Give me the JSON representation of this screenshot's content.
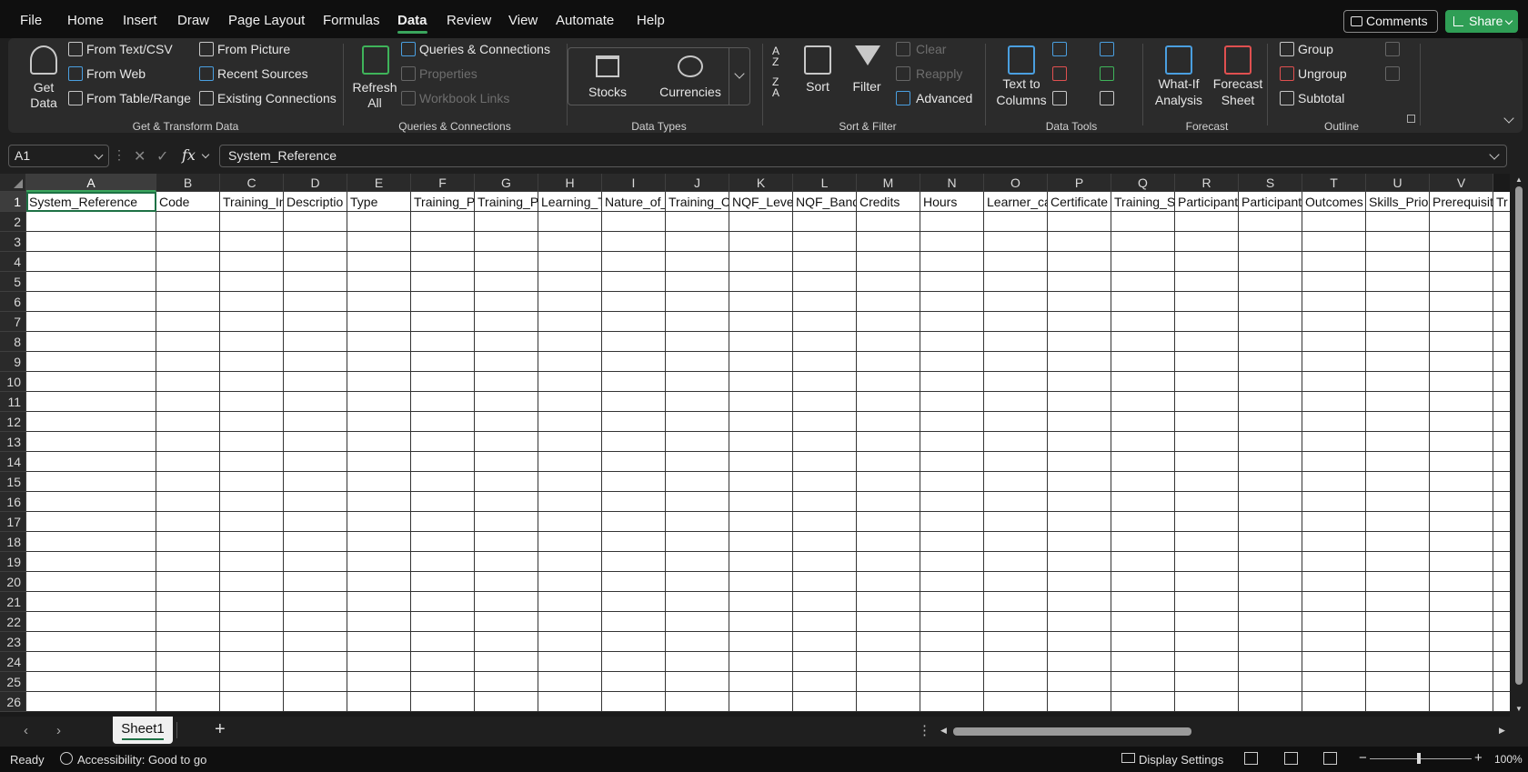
{
  "menu": {
    "tabs": [
      "File",
      "Home",
      "Insert",
      "Draw",
      "Page Layout",
      "Formulas",
      "Data",
      "Review",
      "View",
      "Automate",
      "Help"
    ],
    "active_tab": "Data",
    "comments_label": "Comments",
    "share_label": "Share"
  },
  "ribbon": {
    "get_transform": {
      "get_data_line1": "Get",
      "get_data_line2": "Data",
      "from_text_csv": "From Text/CSV",
      "from_web": "From Web",
      "from_table_range": "From Table/Range",
      "from_picture": "From Picture",
      "recent_sources": "Recent Sources",
      "existing_connections": "Existing Connections",
      "label": "Get & Transform Data"
    },
    "queries": {
      "refresh_line1": "Refresh",
      "refresh_line2": "All",
      "queries_connections": "Queries & Connections",
      "properties": "Properties",
      "workbook_links": "Workbook Links",
      "label": "Queries & Connections"
    },
    "data_types": {
      "stocks": "Stocks",
      "currencies": "Currencies",
      "label": "Data Types"
    },
    "sort_filter": {
      "sort": "Sort",
      "filter": "Filter",
      "clear": "Clear",
      "reapply": "Reapply",
      "advanced": "Advanced",
      "label": "Sort & Filter"
    },
    "data_tools": {
      "text_to_columns_line1": "Text to",
      "text_to_columns_line2": "Columns",
      "label": "Data Tools"
    },
    "forecast": {
      "what_if_line1": "What-If",
      "what_if_line2": "Analysis",
      "forecast_sheet_line1": "Forecast",
      "forecast_sheet_line2": "Sheet",
      "label": "Forecast"
    },
    "outline": {
      "group": "Group",
      "ungroup": "Ungroup",
      "subtotal": "Subtotal",
      "label": "Outline"
    }
  },
  "formula_bar": {
    "name_box": "A1",
    "fx": "fx",
    "value": "System_Reference"
  },
  "grid": {
    "columns": [
      "A",
      "B",
      "C",
      "D",
      "E",
      "F",
      "G",
      "H",
      "I",
      "J",
      "K",
      "L",
      "M",
      "N",
      "O",
      "P",
      "Q",
      "R",
      "S",
      "T",
      "U",
      "V"
    ],
    "row_numbers": [
      "1",
      "2",
      "3",
      "4",
      "5",
      "6",
      "7",
      "8",
      "9",
      "10",
      "11",
      "12",
      "13",
      "14",
      "15",
      "16",
      "17",
      "18",
      "19",
      "20",
      "21",
      "22",
      "23",
      "24",
      "25",
      "26"
    ],
    "header_row": [
      "System_Reference",
      "Code",
      "Training_In",
      "Descriptio",
      "Type",
      "Training_P",
      "Training_P",
      "Learning_T",
      "Nature_of_",
      "Training_C",
      "NQF_Level",
      "NQF_Band",
      "Credits",
      "Hours",
      "Learner_ca",
      "Certificate",
      "Training_Sc",
      "Participant",
      "Participant",
      "Outcomes",
      "Skills_Prio",
      "Prerequisit",
      "Tr"
    ]
  },
  "sheets": {
    "active": "Sheet1"
  },
  "status": {
    "ready": "Ready",
    "accessibility": "Accessibility: Good to go",
    "display_settings": "Display Settings",
    "zoom": "100%"
  }
}
